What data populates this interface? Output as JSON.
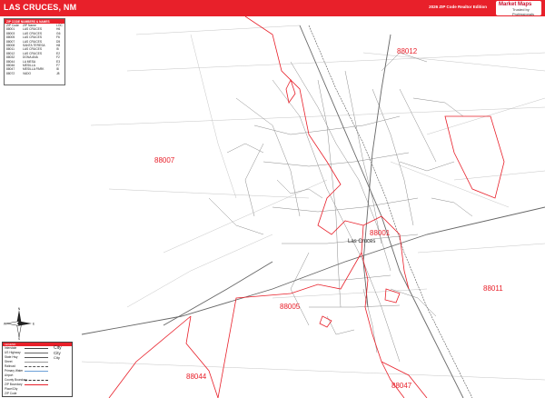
{
  "header": {
    "title": "LAS CRUCES, NM",
    "edition": "2026 ZIP Code Realtor Edition",
    "logo_text": "Market Maps",
    "logo_sub": "Trusted by Professionals",
    "color": "#e8202a"
  },
  "zip_table": {
    "title": "ZIP CODE NUMBERS & NAMES",
    "columns": [
      "ZIP Code",
      "ZIP Name",
      "LOC"
    ],
    "rows": [
      [
        "88001",
        "LAS CRUCES",
        "H6"
      ],
      [
        "88003",
        "LAS CRUCES",
        "G6"
      ],
      [
        "88005",
        "LAS CRUCES",
        "F6"
      ],
      [
        "88007",
        "LAS CRUCES",
        "D5"
      ],
      [
        "88008",
        "SANTA TERESA",
        "H8"
      ],
      [
        "88011",
        "LAS CRUCES",
        "I5"
      ],
      [
        "88012",
        "LAS CRUCES",
        "E2"
      ],
      [
        "88032",
        "DONA ANA",
        "F2"
      ],
      [
        "88044",
        "LA MESA",
        "E3"
      ],
      [
        "88046",
        "MESILLA",
        "F7"
      ],
      [
        "88047",
        "MESILLA PARK",
        "I8"
      ],
      [
        "88072",
        "VADO",
        "J8"
      ]
    ]
  },
  "legend": {
    "title": "LEGEND",
    "items": [
      "Interstate",
      "US Highway",
      "State Hwy",
      "Street",
      "Railroad",
      "Primary Water",
      "Airport",
      "County Boundary",
      "ZIP Boundary",
      "Place/City",
      "ZIP Code"
    ],
    "city_samples": [
      "City",
      "City",
      "City"
    ]
  },
  "map": {
    "zip_labels": [
      {
        "name": "zip-label-88012",
        "text": "88012"
      },
      {
        "name": "zip-label-88007",
        "text": "88007"
      },
      {
        "name": "zip-label-88001",
        "text": "88001"
      },
      {
        "name": "zip-label-88011",
        "text": "88011"
      },
      {
        "name": "zip-label-88005",
        "text": "88005"
      },
      {
        "name": "zip-label-88044",
        "text": "88044"
      },
      {
        "name": "zip-label-88047",
        "text": "88047"
      }
    ],
    "city_label": "Las Cruces",
    "boundary_color": "#e8202a",
    "street_color": "#9a9a9a"
  },
  "compass": {
    "north": "N",
    "south": "S",
    "east": "E",
    "west": "W"
  }
}
